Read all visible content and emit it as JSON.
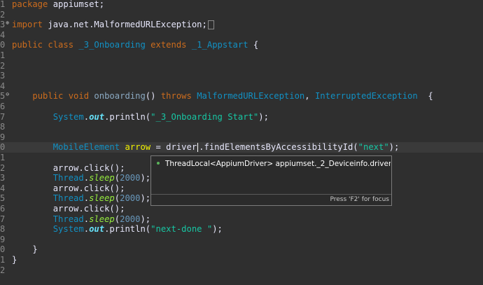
{
  "editor": {
    "lines": [
      {
        "n": "1",
        "marker": "",
        "parts": [
          [
            "kw",
            "package"
          ],
          [
            "pl",
            " appiumset;"
          ]
        ]
      },
      {
        "n": "2",
        "marker": "",
        "parts": []
      },
      {
        "n": "3",
        "marker": "⊕",
        "parts": [
          [
            "kw",
            "import"
          ],
          [
            "pl",
            " java.net.MalformedURLException;"
          ]
        ],
        "box": true
      },
      {
        "n": "4",
        "marker": "",
        "parts": []
      },
      {
        "n": "0",
        "marker": "",
        "parts": [
          [
            "kw",
            "public class"
          ],
          [
            "pl",
            " "
          ],
          [
            "ty",
            "_3_Onboarding"
          ],
          [
            "pl",
            " "
          ],
          [
            "kw",
            "extends"
          ],
          [
            "pl",
            " "
          ],
          [
            "ty",
            "_1_Appstart"
          ],
          [
            "pl",
            " {"
          ]
        ]
      },
      {
        "n": "1",
        "marker": "",
        "parts": []
      },
      {
        "n": "2",
        "marker": "",
        "parts": []
      },
      {
        "n": "3",
        "marker": "",
        "parts": []
      },
      {
        "n": "4",
        "marker": "",
        "parts": []
      },
      {
        "n": "5",
        "marker": "⊖",
        "parts": [
          [
            "pl",
            "    "
          ],
          [
            "kw",
            "public void"
          ],
          [
            "pl",
            " "
          ],
          [
            "mth",
            "onboarding"
          ],
          [
            "pl",
            "() "
          ],
          [
            "kw",
            "throws"
          ],
          [
            "pl",
            " "
          ],
          [
            "ty",
            "MalformedURLException"
          ],
          [
            "pl",
            ", "
          ],
          [
            "ty",
            "InterruptedException"
          ],
          [
            "pl",
            "  {"
          ]
        ]
      },
      {
        "n": "6",
        "marker": "",
        "parts": []
      },
      {
        "n": "7",
        "marker": "",
        "parts": [
          [
            "pl",
            "        "
          ],
          [
            "ty",
            "System"
          ],
          [
            "pl",
            "."
          ],
          [
            "fld",
            "out"
          ],
          [
            "pl",
            ".println("
          ],
          [
            "st",
            "\"_3_Onboarding Start\""
          ],
          [
            "pl",
            ");"
          ]
        ]
      },
      {
        "n": "8",
        "marker": "",
        "parts": []
      },
      {
        "n": "9",
        "marker": "",
        "parts": []
      },
      {
        "n": "0",
        "marker": "",
        "current": true,
        "parts": [
          [
            "pl",
            "        "
          ],
          [
            "ty",
            "MobileElement"
          ],
          [
            "pl",
            " "
          ],
          [
            "var",
            "arrow"
          ],
          [
            "pl",
            " = "
          ],
          [
            "pl",
            "driver"
          ],
          [
            "caret",
            ""
          ],
          [
            "pl",
            ".findElementsByAccessibilityId("
          ],
          [
            "st",
            "\"next\""
          ],
          [
            "pl",
            ");"
          ]
        ]
      },
      {
        "n": "1",
        "marker": "",
        "parts": []
      },
      {
        "n": "2",
        "marker": "",
        "parts": [
          [
            "pl",
            "        arrow.click();"
          ]
        ]
      },
      {
        "n": "3",
        "marker": "",
        "parts": [
          [
            "pl",
            "        "
          ],
          [
            "ty",
            "Thread"
          ],
          [
            "pl",
            "."
          ],
          [
            "smth",
            "sleep"
          ],
          [
            "pl",
            "("
          ],
          [
            "num",
            "2000"
          ],
          [
            "pl",
            ");"
          ]
        ]
      },
      {
        "n": "4",
        "marker": "",
        "parts": [
          [
            "pl",
            "        arrow.click();"
          ]
        ]
      },
      {
        "n": "5",
        "marker": "",
        "parts": [
          [
            "pl",
            "        "
          ],
          [
            "ty",
            "Thread"
          ],
          [
            "pl",
            "."
          ],
          [
            "smth",
            "sleep"
          ],
          [
            "pl",
            "("
          ],
          [
            "num",
            "2000"
          ],
          [
            "pl",
            ");"
          ]
        ]
      },
      {
        "n": "6",
        "marker": "",
        "parts": [
          [
            "pl",
            "        arrow.click();"
          ]
        ]
      },
      {
        "n": "7",
        "marker": "",
        "parts": [
          [
            "pl",
            "        "
          ],
          [
            "ty",
            "Thread"
          ],
          [
            "pl",
            "."
          ],
          [
            "smth",
            "sleep"
          ],
          [
            "pl",
            "("
          ],
          [
            "num",
            "2000"
          ],
          [
            "pl",
            ");"
          ]
        ]
      },
      {
        "n": "8",
        "marker": "",
        "parts": [
          [
            "pl",
            "        "
          ],
          [
            "ty",
            "System"
          ],
          [
            "pl",
            "."
          ],
          [
            "fld",
            "out"
          ],
          [
            "pl",
            ".println("
          ],
          [
            "st",
            "\"next-done \""
          ],
          [
            "pl",
            ");"
          ]
        ]
      },
      {
        "n": "9",
        "marker": "",
        "parts": []
      },
      {
        "n": "0",
        "marker": "",
        "parts": [
          [
            "pl",
            "    }"
          ]
        ]
      },
      {
        "n": "1",
        "marker": "",
        "parts": [
          [
            "pl",
            "}"
          ]
        ]
      },
      {
        "n": "2",
        "marker": "",
        "parts": []
      }
    ]
  },
  "content_assist": {
    "proposal": "ThreadLocal<AppiumDriver> appiumset._2_Deviceinfo.driver",
    "footer": "Press 'F2' for focus"
  },
  "colors": {
    "background": "#2f2f2f",
    "keyword": "#cc6c1d",
    "type": "#1290c3",
    "string": "#17c6a3",
    "variable": "#f2f200"
  }
}
